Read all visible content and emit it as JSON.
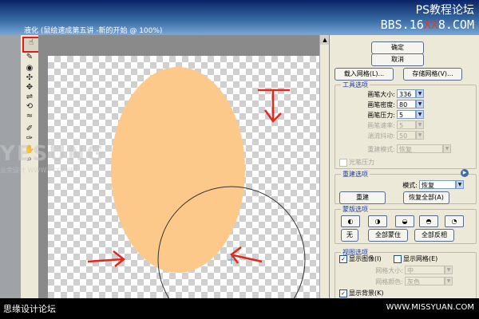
{
  "window": {
    "title": "液化 (鼠绘速成第五讲 -新的开始 @ 100%)",
    "watermark_top": "PS教程论坛",
    "watermark_site_pre": "BBS.16",
    "watermark_site_mid": "XX",
    "watermark_site_post": "8.COM"
  },
  "overlay": {
    "logo": "YESUNG",
    "logo_sub": "业余设计 WWW.YYXV.NET"
  },
  "buttons": {
    "ok": "确定",
    "cancel": "取消",
    "load_mesh": "载入网格(L)...",
    "save_mesh": "存储网格(V)...",
    "reconstruct": "重建",
    "restore_all": "恢复全部(A)",
    "none": "无",
    "mask_all": "全部蒙住",
    "invert_all": "全部反相"
  },
  "tool_options": {
    "title": "工具选项",
    "brush_size_label": "画笔大小:",
    "brush_size": "336",
    "brush_density_label": "画笔密度:",
    "brush_density": "80",
    "brush_pressure_label": "画笔压力:",
    "brush_pressure": "5",
    "brush_rate_label": "画笔速率:",
    "brush_rate": "5",
    "turbulent_jitter_label": "湍流抖动:",
    "turbulent_jitter": "50",
    "reconstruct_mode_label": "重建模式:",
    "reconstruct_mode": "恢复",
    "stylus_pressure_label": "光笔压力"
  },
  "reconstruct_options": {
    "title": "重建选项",
    "mode_label": "模式:",
    "mode": "恢复"
  },
  "mask_options": {
    "title": "蒙版选项"
  },
  "view_options": {
    "title": "视图选项",
    "show_image_label": "显示图像(I)",
    "show_mesh_label": "显示网格(E)",
    "mesh_size_label": "网格大小:",
    "mesh_size": "中",
    "mesh_color_label": "网格颜色:",
    "mesh_color": "灰色",
    "show_backdrop_label": "显示背景(K)"
  },
  "bottom": {
    "left": "思缘设计论坛",
    "right": "WWW.MISSYUAN.COM"
  },
  "colors": {
    "shape_fill": "#fdc98b",
    "arrow": "#e2281c",
    "selection_box": "#e01a1a"
  }
}
